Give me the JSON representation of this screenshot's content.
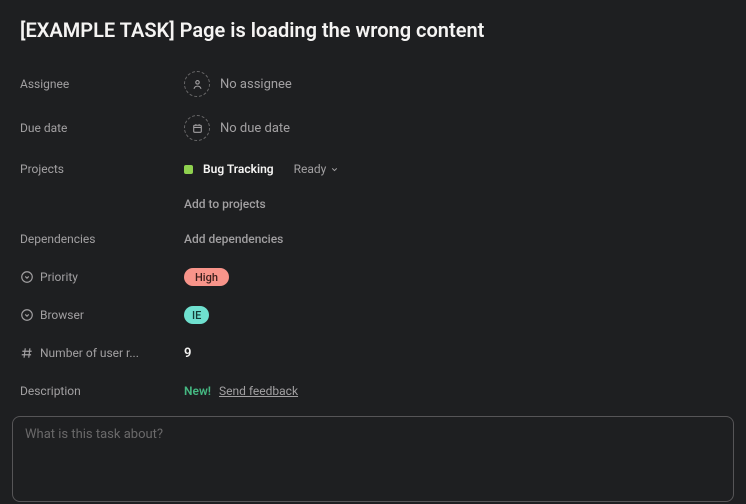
{
  "title": "[EXAMPLE TASK] Page is loading the wrong content",
  "fields": {
    "assignee": {
      "label": "Assignee",
      "value": "No assignee"
    },
    "due_date": {
      "label": "Due date",
      "value": "No due date"
    },
    "projects": {
      "label": "Projects",
      "project_name": "Bug Tracking",
      "project_color": "#8fd14f",
      "status": "Ready",
      "add_label": "Add to projects"
    },
    "dependencies": {
      "label": "Dependencies",
      "add_label": "Add dependencies"
    },
    "priority": {
      "label": "Priority",
      "value": "High",
      "color": "#f8948a"
    },
    "browser": {
      "label": "Browser",
      "value": "IE",
      "color": "#6fe0cf"
    },
    "user_reports": {
      "label": "Number of user r...",
      "value": "9"
    },
    "description": {
      "label": "Description",
      "new_tag": "New!",
      "feedback_link": "Send feedback",
      "placeholder": "What is this task about?"
    }
  }
}
